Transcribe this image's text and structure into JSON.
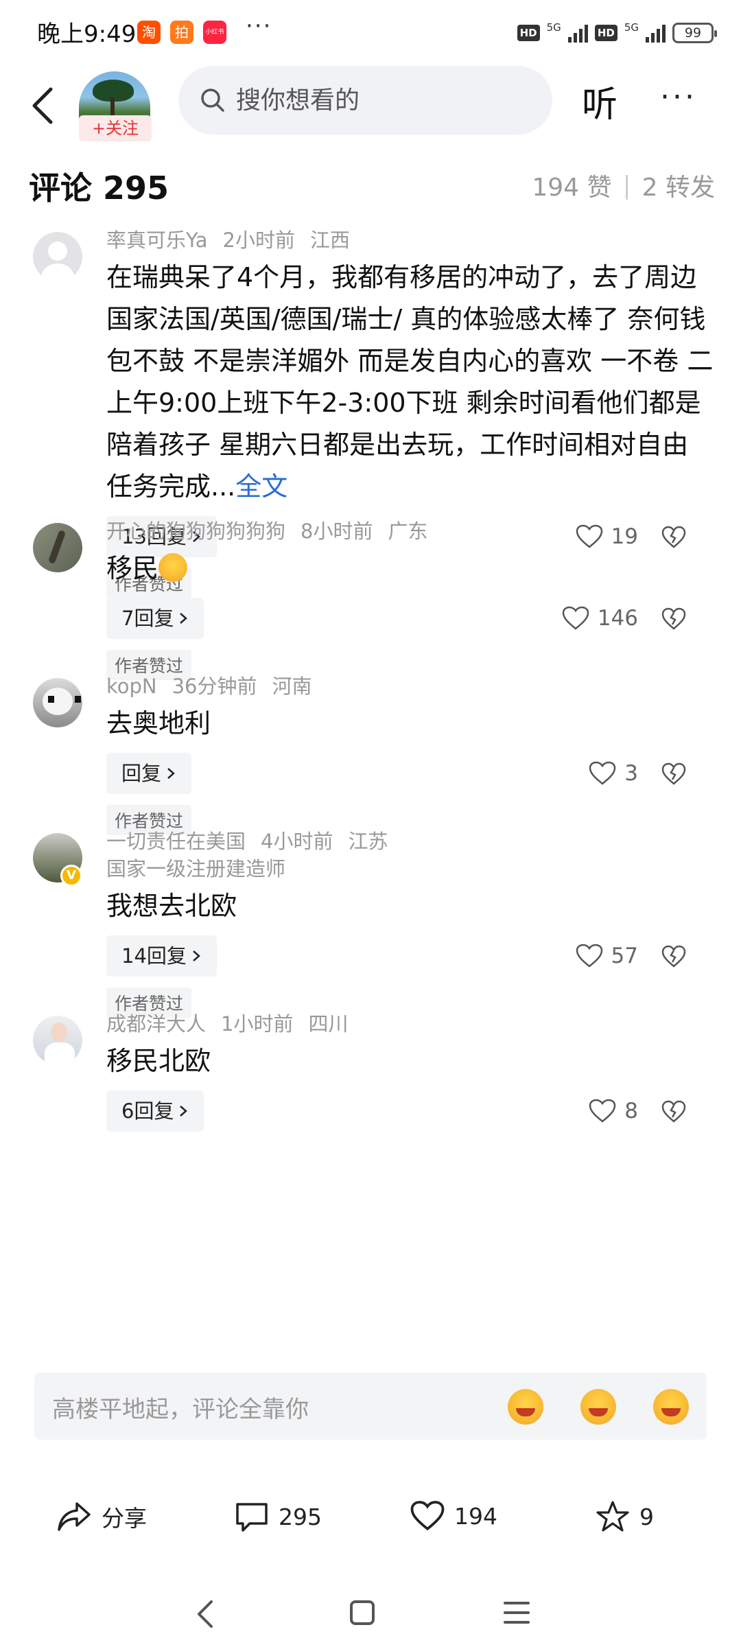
{
  "status_bar": {
    "time": "晚上9:49",
    "apps": [
      {
        "label": "淘",
        "color": "#ff5000"
      },
      {
        "label": "拍",
        "color": "#ff7a1a"
      },
      {
        "label": "小红书",
        "color": "#ff2442"
      }
    ],
    "dots": "···",
    "hd1": "HD",
    "net1": "5G",
    "hd2": "HD",
    "net2": "5G",
    "battery": "99"
  },
  "header": {
    "follow_label": "+关注",
    "search_placeholder": "搜你想看的",
    "listen_label": "听",
    "more_label": "···"
  },
  "comments_header": {
    "title": "评论 295",
    "likes": "194 赞",
    "separator": "|",
    "forwards": "2 转发"
  },
  "comments": [
    {
      "user": "率真可乐Ya",
      "time": "2小时前",
      "location": "江西",
      "text": "在瑞典呆了4个月，我都有移居的冲动了，去了周边国家法国/英国/德国/瑞士/ 真的体验感太棒了 奈何钱包不鼓 不是崇洋媚外 而是发自内心的喜欢 一不卷 二上午9:00上班下午2-3:00下班 剩余时间看他们都是陪着孩子 星期六日都是出去玩，工作时间相对自由 任务完成...",
      "fulltext_link": "全文",
      "reply_label": "13回复",
      "likes": "19",
      "author_liked": "作者赞过"
    },
    {
      "user": "开心的狗狗狗狗狗狗",
      "time": "8小时前",
      "location": "广东",
      "text": "移民",
      "reply_label": "7回复",
      "likes": "146",
      "author_liked": "作者赞过"
    },
    {
      "user": "kopN",
      "time": "36分钟前",
      "location": "河南",
      "text": "去奥地利",
      "reply_label": "回复",
      "likes": "3",
      "author_liked": "作者赞过"
    },
    {
      "user": "一切责任在美国",
      "time": "4小时前",
      "location": "江苏",
      "subtitle": "国家一级注册建造师",
      "verified_mark": "V",
      "text": "我想去北欧",
      "reply_label": "14回复",
      "likes": "57",
      "author_liked": "作者赞过"
    },
    {
      "user": "成都洋大人",
      "time": "1小时前",
      "location": "四川",
      "text": "移民北欧",
      "reply_label": "6回复",
      "likes": "8"
    }
  ],
  "input_bar": {
    "placeholder": "高楼平地起，评论全靠你",
    "emoji_icons": [
      "laughing-emoji-icon",
      "grinning-emoji-icon",
      "rofl-emoji-icon"
    ]
  },
  "bottom_bar": {
    "share_label": "分享",
    "comment_count": "295",
    "like_count": "194",
    "favorite_count": "9"
  },
  "nav_bar": {
    "icons": [
      "nav-back-icon",
      "nav-home-icon",
      "nav-menu-icon"
    ]
  }
}
